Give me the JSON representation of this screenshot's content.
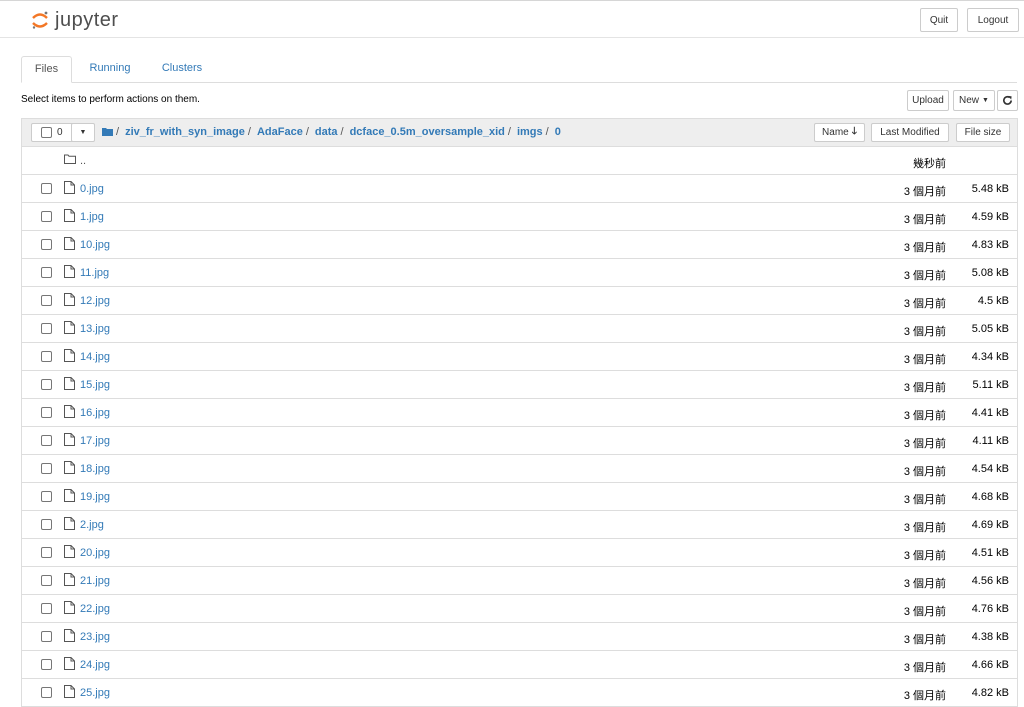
{
  "app": {
    "logo_text": "jupyter"
  },
  "header": {
    "quit_label": "Quit",
    "logout_label": "Logout"
  },
  "tabs": [
    {
      "label": "Files"
    },
    {
      "label": "Running"
    },
    {
      "label": "Clusters"
    }
  ],
  "toolbar": {
    "hint": "Select items to perform actions on them.",
    "upload_label": "Upload",
    "new_label": "New",
    "refresh_icon": "refresh-icon"
  },
  "list_header": {
    "selected_count": "0",
    "breadcrumb": [
      "ziv_fr_with_syn_image",
      "AdaFace",
      "data",
      "dcface_0.5m_oversample_xid",
      "imgs",
      "0"
    ],
    "sort_name_label": "Name",
    "sort_modified_label": "Last Modified",
    "sort_size_label": "File size"
  },
  "parent_row": {
    "name": "..",
    "modified": "幾秒前"
  },
  "files": [
    {
      "name": "0.jpg",
      "modified": "3 個月前",
      "size": "5.48 kB"
    },
    {
      "name": "1.jpg",
      "modified": "3 個月前",
      "size": "4.59 kB"
    },
    {
      "name": "10.jpg",
      "modified": "3 個月前",
      "size": "4.83 kB"
    },
    {
      "name": "11.jpg",
      "modified": "3 個月前",
      "size": "5.08 kB"
    },
    {
      "name": "12.jpg",
      "modified": "3 個月前",
      "size": "4.5 kB"
    },
    {
      "name": "13.jpg",
      "modified": "3 個月前",
      "size": "5.05 kB"
    },
    {
      "name": "14.jpg",
      "modified": "3 個月前",
      "size": "4.34 kB"
    },
    {
      "name": "15.jpg",
      "modified": "3 個月前",
      "size": "5.11 kB"
    },
    {
      "name": "16.jpg",
      "modified": "3 個月前",
      "size": "4.41 kB"
    },
    {
      "name": "17.jpg",
      "modified": "3 個月前",
      "size": "4.11 kB"
    },
    {
      "name": "18.jpg",
      "modified": "3 個月前",
      "size": "4.54 kB"
    },
    {
      "name": "19.jpg",
      "modified": "3 個月前",
      "size": "4.68 kB"
    },
    {
      "name": "2.jpg",
      "modified": "3 個月前",
      "size": "4.69 kB"
    },
    {
      "name": "20.jpg",
      "modified": "3 個月前",
      "size": "4.51 kB"
    },
    {
      "name": "21.jpg",
      "modified": "3 個月前",
      "size": "4.56 kB"
    },
    {
      "name": "22.jpg",
      "modified": "3 個月前",
      "size": "4.76 kB"
    },
    {
      "name": "23.jpg",
      "modified": "3 個月前",
      "size": "4.38 kB"
    },
    {
      "name": "24.jpg",
      "modified": "3 個月前",
      "size": "4.66 kB"
    },
    {
      "name": "25.jpg",
      "modified": "3 個月前",
      "size": "4.82 kB"
    }
  ],
  "colors": {
    "link": "#337ab7",
    "logo_orange": "#f37726",
    "header_bg": "#eeeeee"
  }
}
